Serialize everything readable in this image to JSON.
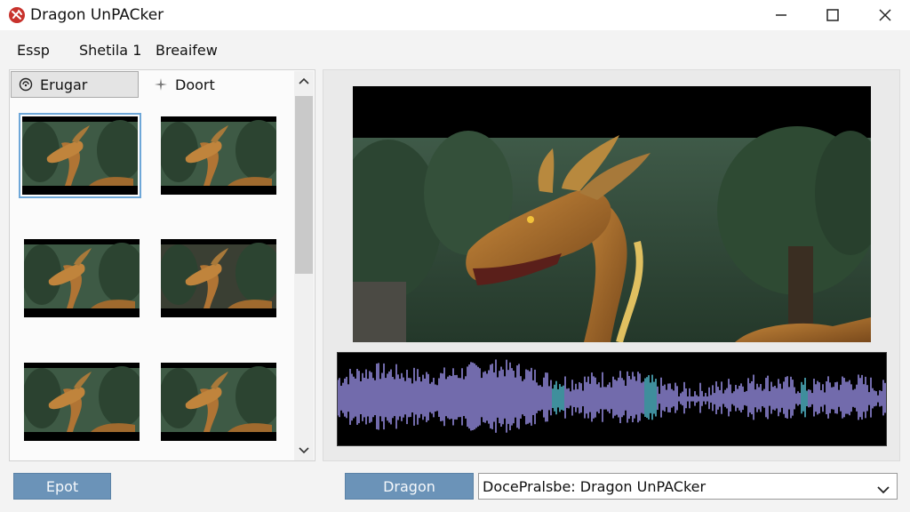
{
  "window": {
    "title": "Dragon UnPACker",
    "controls": [
      "minimize",
      "maximize",
      "close"
    ]
  },
  "menu": {
    "items": [
      "Essp",
      "Shetila 1",
      "Breaifew"
    ]
  },
  "left_panel": {
    "tabs": [
      {
        "label": "Erugar",
        "icon": "disc-icon",
        "active": true
      },
      {
        "label": "Doort",
        "icon": "sparkle-icon",
        "active": false
      }
    ],
    "thumbnails": [
      {
        "name": "dragon-forest-1",
        "selected": true
      },
      {
        "name": "dragon-forest-2",
        "selected": false
      },
      {
        "name": "dragon-forest-3",
        "selected": false
      },
      {
        "name": "dragon-forest-dark",
        "selected": false
      },
      {
        "name": "dragon-forest-5",
        "selected": false
      },
      {
        "name": "dragon-forest-6",
        "selected": false
      }
    ]
  },
  "preview": {
    "subject": "dragon in forest"
  },
  "waveform": {
    "color": "#8f86d8",
    "highlight_color": "#4fb3c4"
  },
  "bottom": {
    "export_button": "Epot",
    "dragon_button": "Dragon",
    "dropdown_value": "DocePralsbe: Dragon UnPACker"
  },
  "colors": {
    "button_bg": "#6b93b8",
    "selection_outline": "#6ea7d8"
  }
}
